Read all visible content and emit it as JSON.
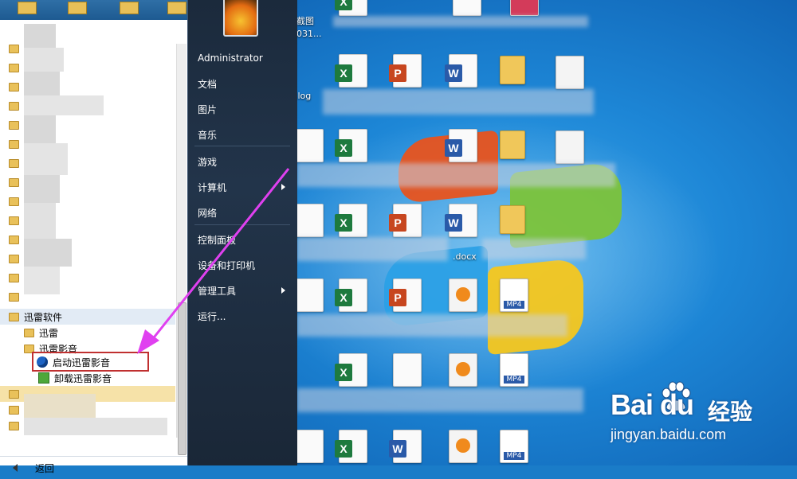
{
  "start_menu": {
    "user": "Administrator",
    "right_items": [
      {
        "label": "文档",
        "has_submenu": false
      },
      {
        "label": "图片",
        "has_submenu": false
      },
      {
        "label": "音乐",
        "has_submenu": false
      },
      {
        "label": "游戏",
        "has_submenu": false
      },
      {
        "label": "计算机",
        "has_submenu": true
      },
      {
        "label": "网络",
        "has_submenu": false
      },
      {
        "label": "控制面板",
        "has_submenu": false
      },
      {
        "label": "设备和打印机",
        "has_submenu": false
      },
      {
        "label": "管理工具",
        "has_submenu": true
      },
      {
        "label": "运行...",
        "has_submenu": false
      }
    ],
    "programs": {
      "folder_xunlei_software": "迅雷软件",
      "folder_xunlei": "迅雷",
      "folder_xunlei_player": "迅雷影音",
      "launch_player": "启动迅雷影音",
      "uninstall_player": "卸载迅雷影音"
    },
    "back_label": "返回"
  },
  "desktop": {
    "labels": {
      "screenshot": "截图",
      "screenshot_sub": "031...",
      "log": ".log",
      "docx": ".docx",
      "mp4": "MP4"
    }
  },
  "watermark": {
    "brand": "Bai du",
    "brand_cn": "经验",
    "url": "jingyan.baidu.com"
  },
  "colors": {
    "annotation_arrow": "#e040f0",
    "highlight_box": "#c03030"
  }
}
